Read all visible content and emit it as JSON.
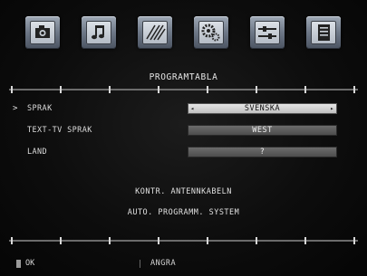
{
  "menu_icons": [
    {
      "name": "picture-icon"
    },
    {
      "name": "sound-icon"
    },
    {
      "name": "features-icon"
    },
    {
      "name": "settings-icon"
    },
    {
      "name": "source-icon"
    },
    {
      "name": "program-table-icon"
    }
  ],
  "header": {
    "title": "PROGRAMTABLA"
  },
  "settings": [
    {
      "label": "SPRAK",
      "value": "SVENSKA",
      "selected": true
    },
    {
      "label": "TEXT-TV SPRAK",
      "value": "WEST",
      "selected": false
    },
    {
      "label": "LAND",
      "value": "?",
      "selected": false
    }
  ],
  "actions": {
    "antenna_check": "KONTR. ANTENNKABELN",
    "auto_program": "AUTO. PROGRAMM. SYSTEM"
  },
  "footer": {
    "ok_label": "OK",
    "cancel_label": "ANGRA"
  },
  "colors": {
    "background": "#0a0a0a",
    "highlight": "#e0e0e0",
    "field": "#5a5a5a"
  }
}
